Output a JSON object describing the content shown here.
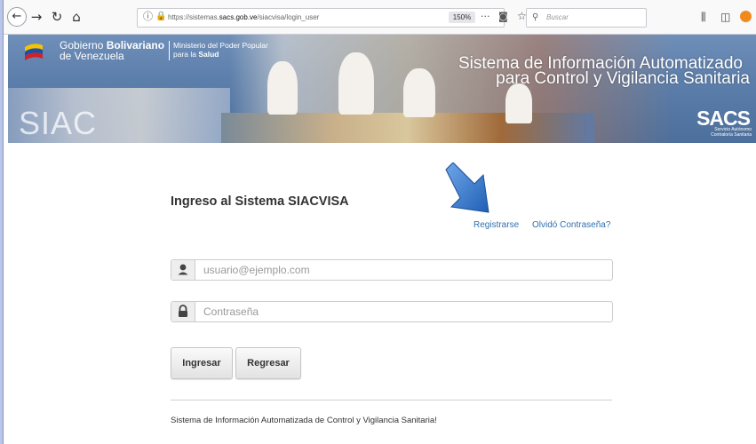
{
  "browser": {
    "url_prefix": "https://sistemas.",
    "url_domain": "sacs.gob.ve",
    "url_path": "/siacvisa/login_user",
    "zoom": "150%",
    "search_placeholder": "Buscar"
  },
  "banner": {
    "gobierno_prefix": "Gobierno ",
    "gobierno_bold": "Bolivariano",
    "gobierno_line2": "de Venezuela",
    "ministerio_line1": "Ministerio del Poder Popular",
    "ministerio_line2_prefix": "para la ",
    "ministerio_line2_bold": "Salud",
    "system_title_line1": "Sistema de Información  Automatizado",
    "system_title_line2": "para Control y Vigilancia Sanitaria",
    "watermark": "SIAC",
    "sacs_logo": "SACS",
    "sacs_sub_line1": "Servicio Autónomo",
    "sacs_sub_line2": "Contraloría Sanitaria"
  },
  "login": {
    "title": "Ingreso al Sistema SIACVISA",
    "register_link": "Registrarse",
    "forgot_link": "Olvidó Contraseña?",
    "email_placeholder": "usuario@ejemplo.com",
    "password_placeholder": "Contraseña",
    "login_button": "Ingresar",
    "back_button": "Regresar",
    "footer_text": "Sistema de Información Automatizada de Control y Vigilancia Sanitaria!"
  },
  "colors": {
    "link": "#3070b0",
    "banner_blue": "#5d7fab",
    "pointer_arrow": "#3a78c8"
  }
}
